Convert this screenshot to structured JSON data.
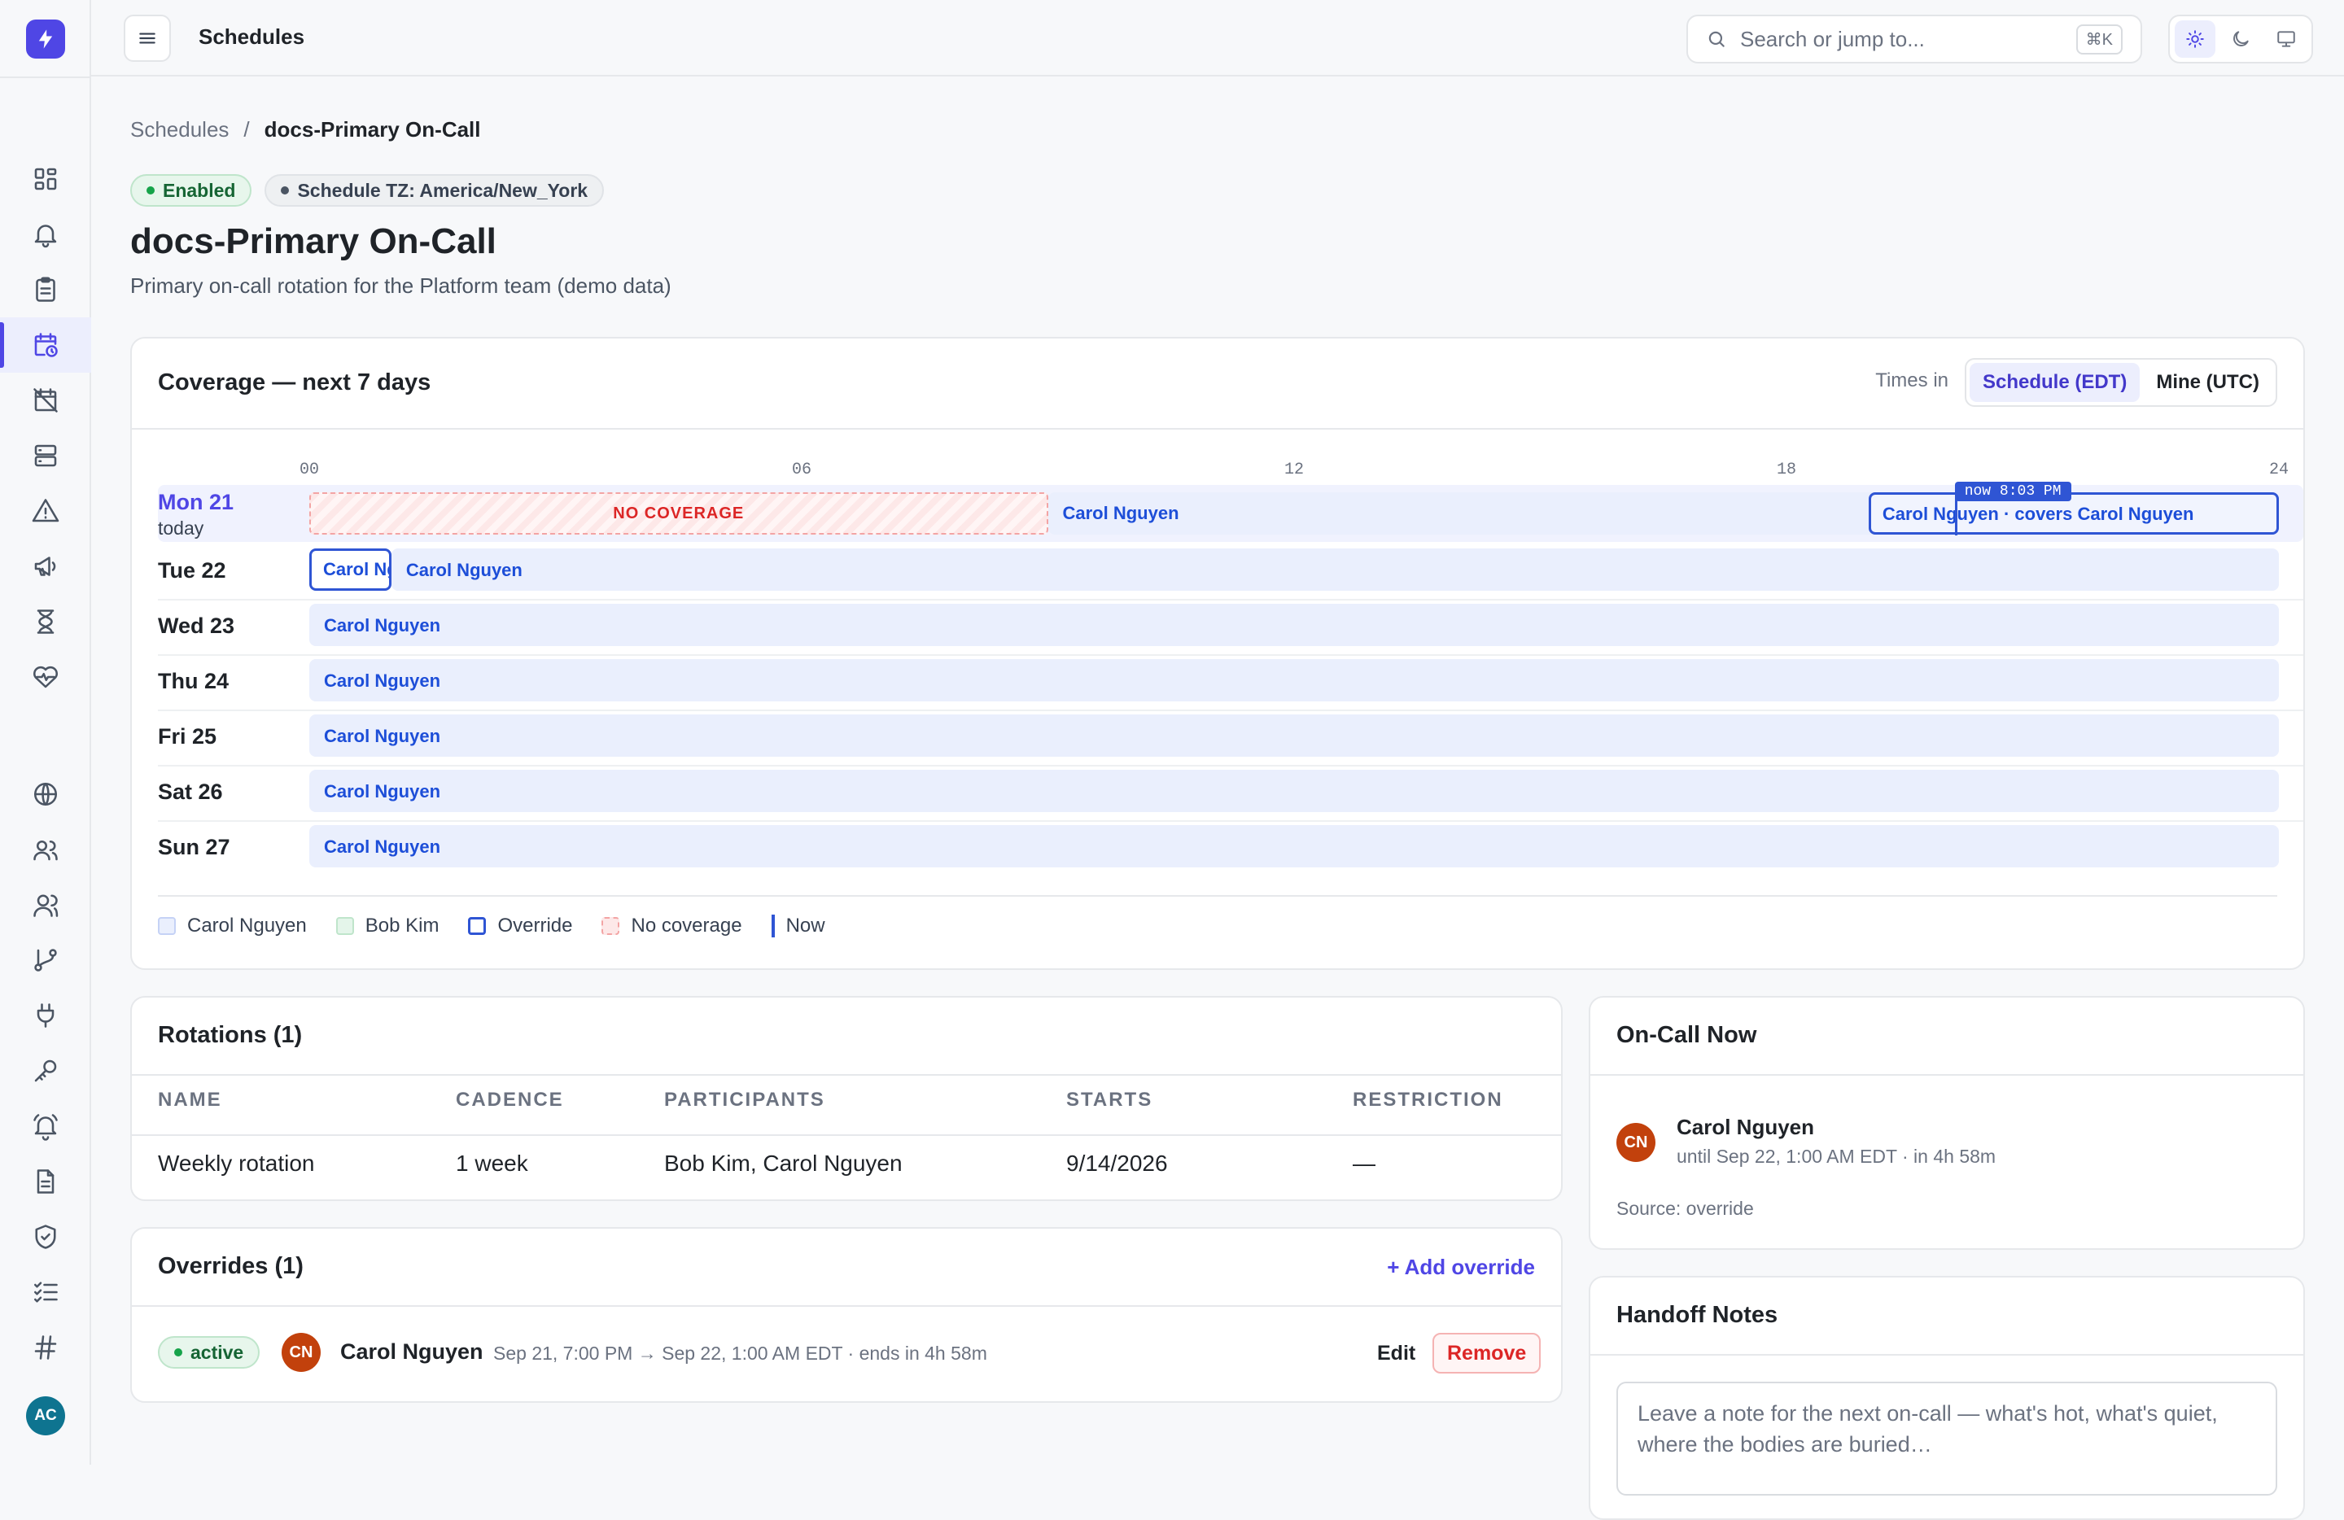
{
  "topbar": {
    "title": "Schedules",
    "search_placeholder": "Search or jump to...",
    "search_shortcut": "⌘K"
  },
  "rail": {
    "logo": "bolt-icon",
    "avatar_initials": "AC",
    "items": [
      "dashboard-icon",
      "bell-icon",
      "clipboard-icon",
      "calendar-clock-icon",
      "calendar-off-icon",
      "server-icon",
      "warning-icon",
      "megaphone-icon",
      "hourglass-icon",
      "heart-pulse-icon",
      "globe-icon",
      "users-icon",
      "team-icon",
      "git-branch-icon",
      "plug-icon",
      "key-icon",
      "bell-ring-icon",
      "document-icon",
      "shield-check-icon",
      "checklist-icon",
      "hash-icon"
    ],
    "active_item": "calendar-clock-icon"
  },
  "breadcrumb": {
    "parent": "Schedules",
    "separator": "/",
    "current": "docs-Primary On-Call"
  },
  "badges": {
    "status": "Enabled",
    "timezone": "Schedule TZ: America/New_York"
  },
  "page": {
    "title": "docs-Primary On-Call",
    "description": "Primary on-call rotation for the Platform team (demo data)"
  },
  "coverage": {
    "title": "Coverage — next 7 days",
    "times_in_label": "Times in",
    "tz_options": [
      "Schedule (EDT)",
      "Mine (UTC)"
    ],
    "tz_selected": "Schedule (EDT)",
    "ticks": [
      "00",
      "06",
      "12",
      "18",
      "24"
    ],
    "days": [
      {
        "label": "Mon 21",
        "sub": "today",
        "today": true
      },
      {
        "label": "Tue 22"
      },
      {
        "label": "Wed 23"
      },
      {
        "label": "Thu 24"
      },
      {
        "label": "Fri 25"
      },
      {
        "label": "Sat 26"
      },
      {
        "label": "Sun 27"
      }
    ],
    "no_coverage_label": "NO COVERAGE",
    "shift_label": "Carol Nguyen",
    "override_label": "Carol Nguyen · covers Carol Nguyen",
    "tue_override_label": "Carol Nguyen",
    "now_label": "now 8:03 PM",
    "now_hour": 20.05,
    "segments": {
      "mon_no_coverage": [
        0,
        9
      ],
      "mon_shift": [
        9,
        24
      ],
      "mon_override": [
        19,
        24
      ],
      "tue_override": [
        0,
        1
      ]
    },
    "legend": [
      "Carol Nguyen",
      "Bob Kim",
      "Override",
      "No coverage",
      "Now"
    ],
    "colors": {
      "carol": "#eaeffd",
      "bob": "#e4f5ea",
      "override": "#2f55d4",
      "no_coverage": "#f3a4a4",
      "now": "#2f55d4"
    }
  },
  "rotations": {
    "title": "Rotations (1)",
    "headers": [
      "NAME",
      "CADENCE",
      "PARTICIPANTS",
      "STARTS",
      "RESTRICTION"
    ],
    "rows": [
      [
        "Weekly rotation",
        "1 week",
        "Bob Kim, Carol Nguyen",
        "9/14/2026",
        "—"
      ]
    ]
  },
  "overrides": {
    "title": "Overrides (1)",
    "add_label": "+ Add override",
    "items": [
      {
        "status": "active",
        "initials": "CN",
        "name": "Carol Nguyen",
        "window": "Sep 21, 7:00 PM → Sep 22, 1:00 AM EDT · ends in 4h 58m",
        "edit": "Edit",
        "remove": "Remove"
      }
    ]
  },
  "oncall_now": {
    "title": "On-Call Now",
    "initials": "CN",
    "name": "Carol Nguyen",
    "until": "until Sep 22, 1:00 AM EDT · in 4h 58m",
    "source": "Source: override"
  },
  "handoff": {
    "title": "Handoff Notes",
    "placeholder": "Leave a note for the next on-call — what's hot, what's quiet, where the bodies are buried…"
  }
}
